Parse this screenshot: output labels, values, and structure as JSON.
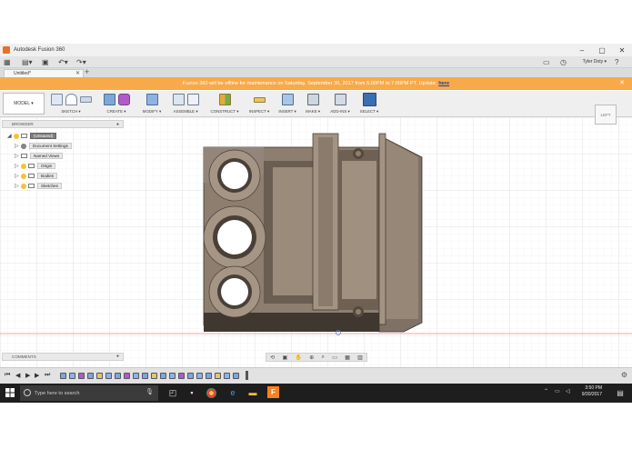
{
  "window": {
    "title": "Autodesk Fusion 360"
  },
  "toolbar": {
    "user": "Tyler Doty ▾"
  },
  "doc_tab": {
    "name": "Untitled*"
  },
  "banner": {
    "message": "Fusion 360 will be offline for maintenance on Saturday, September 30, 2017 from 5:00PM to 7:00PM PT. Update:",
    "link": "here"
  },
  "ribbon": {
    "workspace": "MODEL ▾",
    "groups": [
      {
        "label": "SKETCH ▾"
      },
      {
        "label": "CREATE ▾"
      },
      {
        "label": "MODIFY ▾"
      },
      {
        "label": "ASSEMBLE ▾"
      },
      {
        "label": "CONSTRUCT ▾"
      },
      {
        "label": "INSPECT ▾"
      },
      {
        "label": "INSERT ▾"
      },
      {
        "label": "MAKE ▾"
      },
      {
        "label": "ADD-INS ▾"
      },
      {
        "label": "SELECT ▾"
      }
    ]
  },
  "browser": {
    "title": "BROWSER",
    "items": [
      {
        "label": "(Unsaved)"
      },
      {
        "label": "Document Settings"
      },
      {
        "label": "Named Views"
      },
      {
        "label": "Origin"
      },
      {
        "label": "Bodies"
      },
      {
        "label": "Sketches"
      }
    ]
  },
  "comments": {
    "title": "COMMENTS"
  },
  "viewcube": {
    "label": "LEFT"
  },
  "taskbar": {
    "search_placeholder": "Type here to search",
    "time": "3:50 PM",
    "date": "9/30/2017"
  },
  "colors": {
    "banner": "#f8a94a",
    "body_face": "#8d7e6f",
    "body_dark": "#6a5d51",
    "selection_blue": "#3a6fb0"
  }
}
